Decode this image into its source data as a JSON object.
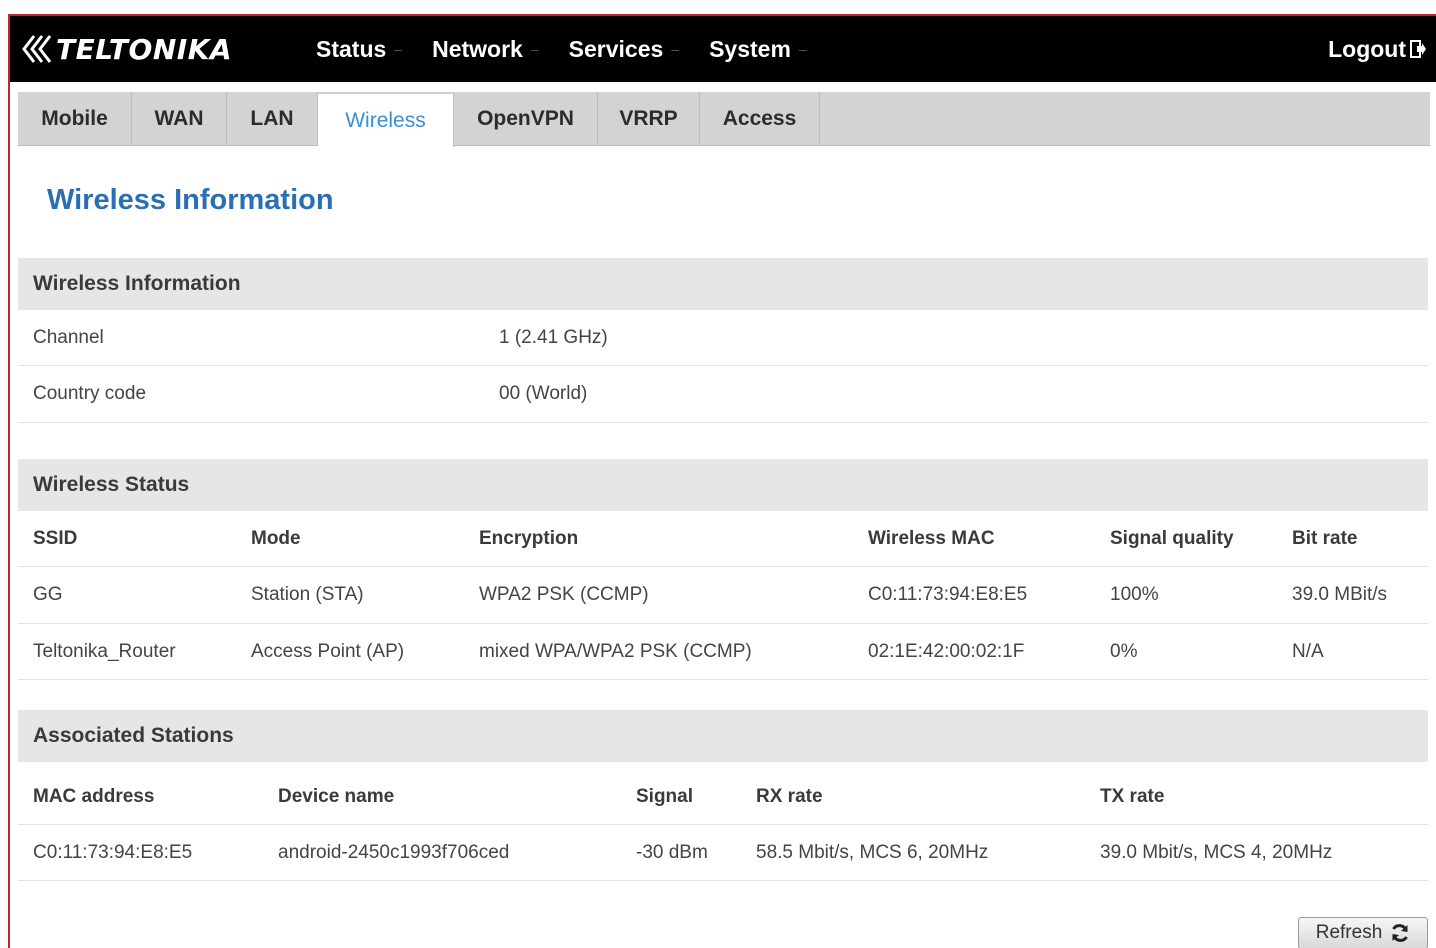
{
  "brand": {
    "name": "TELTONIKA"
  },
  "menu": [
    {
      "label": "Status"
    },
    {
      "label": "Network"
    },
    {
      "label": "Services"
    },
    {
      "label": "System"
    }
  ],
  "logout_label": "Logout",
  "tabs": [
    {
      "label": "Mobile"
    },
    {
      "label": "WAN"
    },
    {
      "label": "LAN"
    },
    {
      "label": "Wireless",
      "active": true
    },
    {
      "label": "OpenVPN"
    },
    {
      "label": "VRRP"
    },
    {
      "label": "Access"
    }
  ],
  "page_title": "Wireless Information",
  "wireless_info": {
    "title": "Wireless Information",
    "rows": [
      {
        "key": "Channel",
        "value": "1 (2.41 GHz)"
      },
      {
        "key": "Country code",
        "value": "00 (World)"
      }
    ]
  },
  "wireless_status": {
    "title": "Wireless Status",
    "columns": [
      "SSID",
      "Mode",
      "Encryption",
      "Wireless MAC",
      "Signal quality",
      "Bit rate"
    ],
    "rows": [
      [
        "GG",
        "Station (STA)",
        "WPA2 PSK (CCMP)",
        "C0:11:73:94:E8:E5",
        "100%",
        "39.0 MBit/s"
      ],
      [
        "Teltonika_Router",
        "Access Point (AP)",
        "mixed WPA/WPA2 PSK (CCMP)",
        "02:1E:42:00:02:1F",
        "0%",
        "N/A"
      ]
    ]
  },
  "associated_stations": {
    "title": "Associated Stations",
    "columns": [
      "MAC address",
      "Device name",
      "Signal",
      "RX rate",
      "TX rate"
    ],
    "rows": [
      [
        "C0:11:73:94:E8:E5",
        "android-2450c1993f706ced",
        "-30 dBm",
        "58.5 Mbit/s, MCS 6, 20MHz",
        "39.0 Mbit/s, MCS 4, 20MHz"
      ]
    ]
  },
  "refresh_label": "Refresh",
  "colors": {
    "accent": "#2a6fb3",
    "active_tab": "#3a8fd4",
    "frame": "#c0262d"
  }
}
